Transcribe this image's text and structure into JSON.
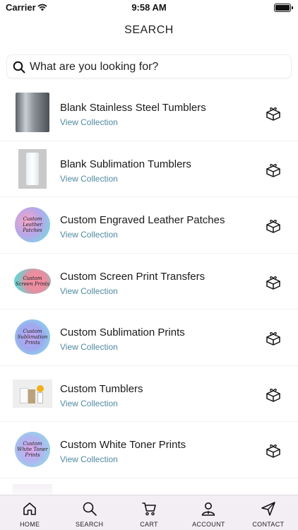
{
  "status": {
    "carrier": "Carrier",
    "time": "9:58 AM"
  },
  "header": {
    "title": "SEARCH"
  },
  "search": {
    "placeholder": "What are you looking for?"
  },
  "results": [
    {
      "title": "Blank Stainless Steel Tumblers",
      "subtitle": "View Collection",
      "thumb": "steel-tumbler"
    },
    {
      "title": "Blank Sublimation Tumblers",
      "subtitle": "View Collection",
      "thumb": "white-tumbler"
    },
    {
      "title": "Custom Engraved Leather Patches",
      "subtitle": "View Collection",
      "thumb": "leather-logo",
      "logo_text": "Custom Leather Patches"
    },
    {
      "title": "Custom Screen Print Transfers",
      "subtitle": "View Collection",
      "thumb": "screen-print-logo",
      "logo_text": "Custom Screen Prints"
    },
    {
      "title": "Custom Sublimation Prints",
      "subtitle": "View Collection",
      "thumb": "sublimation-logo",
      "logo_text": "Custom Sublimation Prints"
    },
    {
      "title": "Custom Tumblers",
      "subtitle": "View Collection",
      "thumb": "tumbler-photo"
    },
    {
      "title": "Custom White Toner Prints",
      "subtitle": "View Collection",
      "thumb": "white-toner-logo",
      "logo_text": "Custom White Toner Prints"
    }
  ],
  "tabs": [
    {
      "label": "HOME",
      "icon": "home-icon"
    },
    {
      "label": "SEARCH",
      "icon": "search-icon"
    },
    {
      "label": "CART",
      "icon": "cart-icon"
    },
    {
      "label": "ACCOUNT",
      "icon": "account-icon"
    },
    {
      "label": "CONTACT",
      "icon": "send-icon"
    }
  ],
  "colors": {
    "link": "#4f8aa1",
    "tab_bar_bg": "#f3eef3"
  }
}
